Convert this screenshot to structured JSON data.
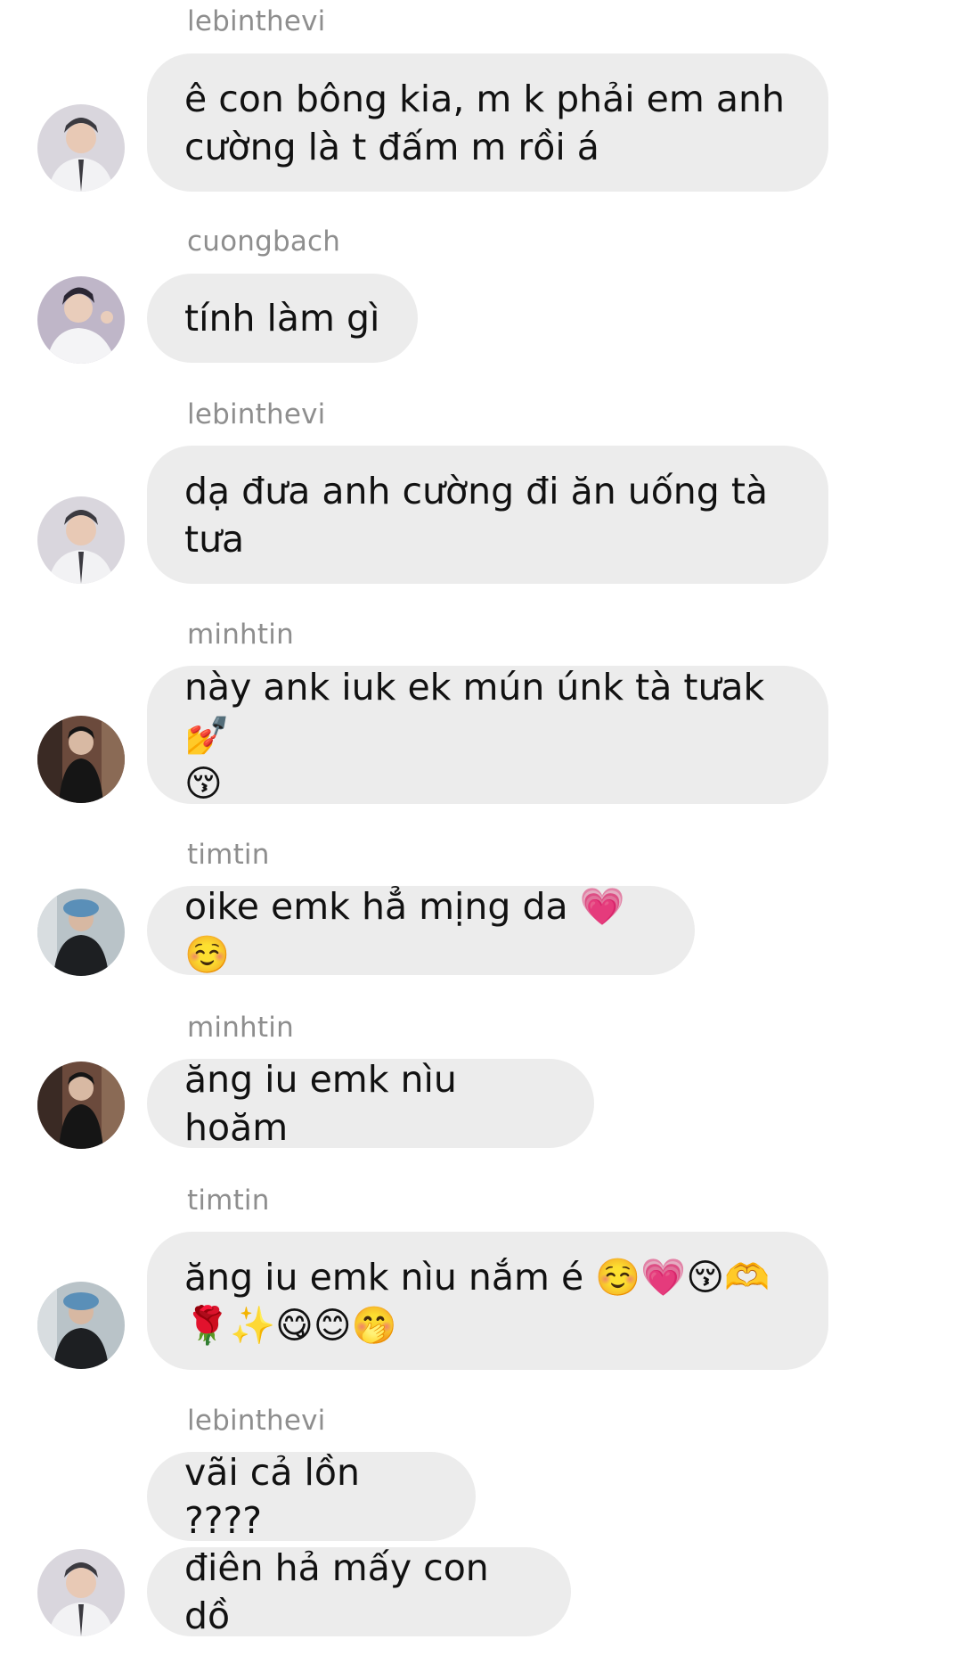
{
  "messages": [
    {
      "sender": "lebinthevi",
      "text": "ê con bông kia, m k phải em anh\ncường là t đấm m rồi á"
    },
    {
      "sender": "cuongbach",
      "text": "tính làm gì"
    },
    {
      "sender": "lebinthevi",
      "text": "dạ đưa anh cường đi ăn uống tà\ntưa"
    },
    {
      "sender": "minhtin",
      "text": "này ank iuk ek mún únk tà tưak💅\n😚"
    },
    {
      "sender": "timtin",
      "text": "oike emk hẳ mịng da 💗☺️"
    },
    {
      "sender": "minhtin",
      "text": "ăng iu emk nìu hoăm"
    },
    {
      "sender": "timtin",
      "text": "ăng iu emk nìu nắm é ☺️💗😚🫶\n🌹✨😋😊🤭"
    },
    {
      "sender": "lebinthevi",
      "text": "vãi cả lồn ????"
    },
    {
      "sender": "",
      "text": "điên hả mấy con dồ"
    }
  ],
  "avatars": [
    {
      "user": "lebinthevi",
      "icon": "profile-photo-icon",
      "bg": "#d9d6dd",
      "fg": "#3b3a40"
    },
    {
      "user": "cuongbach",
      "icon": "profile-photo-icon",
      "bg": "#bfb6c8",
      "fg": "#2a2633"
    },
    {
      "user": "minhtin",
      "icon": "profile-photo-icon",
      "bg": "#6b4a3c",
      "fg": "#151515"
    },
    {
      "user": "timtin",
      "icon": "profile-photo-icon",
      "bg": "#b9c3c8",
      "fg": "#1d1f22"
    }
  ]
}
